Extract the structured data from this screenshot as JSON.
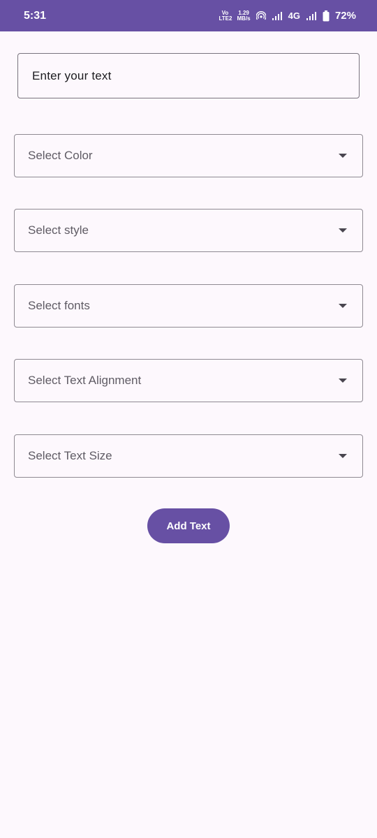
{
  "status_bar": {
    "time": "5:31",
    "volte_label": "Vo LTE2",
    "speed_value": "1.29",
    "speed_unit": "MB/s",
    "network_label": "4G",
    "battery_percent": "72%"
  },
  "text_input": {
    "placeholder": "Enter your text"
  },
  "dropdowns": [
    {
      "label": "Select Color"
    },
    {
      "label": "Select style"
    },
    {
      "label": "Select fonts"
    },
    {
      "label": "Select Text Alignment"
    },
    {
      "label": "Select Text Size"
    }
  ],
  "add_button": {
    "label": "Add Text"
  },
  "colors": {
    "accent": "#6750a4",
    "background": "#fdf8fd"
  }
}
